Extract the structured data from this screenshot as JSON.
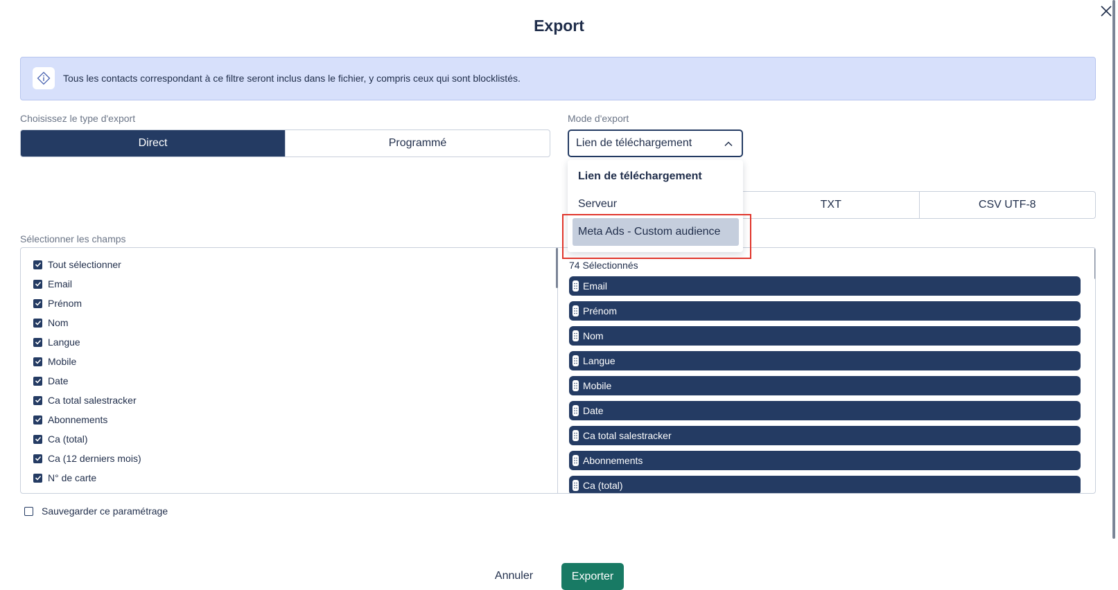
{
  "dialog": {
    "title": "Export",
    "info_text": "Tous les contacts correspondant à ce filtre seront inclus dans le fichier, y compris ceux qui sont blocklistés."
  },
  "export_type": {
    "label": "Choisissez le type d'export",
    "options": [
      "Direct",
      "Programmé"
    ],
    "selected": "Direct"
  },
  "export_mode": {
    "label": "Mode d'export",
    "value": "Lien de téléchargement",
    "dropdown_open": true,
    "options": [
      "Lien de téléchargement",
      "Serveur",
      "Meta Ads - Custom audience"
    ],
    "highlighted": "Meta Ads - Custom audience"
  },
  "file_format": {
    "visible_options": [
      "TXT",
      "CSV UTF-8"
    ]
  },
  "fields": {
    "label": "Sélectionner les champs",
    "select_all": "Tout sélectionner",
    "items": [
      "Email",
      "Prénom",
      "Nom",
      "Langue",
      "Mobile",
      "Date",
      "Ca total salestracker",
      "Abonnements",
      "Ca (total)",
      "Ca (12 derniers mois)",
      "N° de carte"
    ],
    "selected_count_text": "74 Sélectionnés",
    "selected_items": [
      "Email",
      "Prénom",
      "Nom",
      "Langue",
      "Mobile",
      "Date",
      "Ca total salestracker",
      "Abonnements",
      "Ca (total)"
    ]
  },
  "save_setting": {
    "label": "Sauvegarder ce paramétrage",
    "checked": false
  },
  "actions": {
    "cancel": "Annuler",
    "export": "Exporter"
  },
  "colors": {
    "primary": "#243b63",
    "accent_green": "#187a64",
    "info_bg": "#d7e0fb",
    "highlight_frame": "#e0342a"
  },
  "icons": [
    "close-icon",
    "info-diamond-icon",
    "chevron-up-icon",
    "checkbox-checked-icon",
    "drag-handle-icon"
  ]
}
